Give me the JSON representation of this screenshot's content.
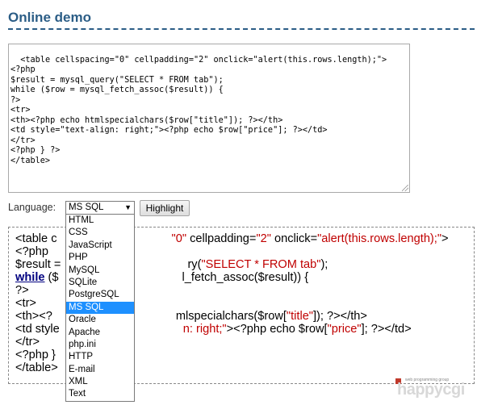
{
  "header": {
    "title": "Online demo"
  },
  "editor": {
    "code": "<table cellspacing=\"0\" cellpadding=\"2\" onclick=\"alert(this.rows.length);\">\n<?php\n$result = mysql_query(\"SELECT * FROM tab\");\nwhile ($row = mysql_fetch_assoc($result)) {\n?>\n<tr>\n<th><?php echo htmlspecialchars($row[\"title\"]); ?></th>\n<td style=\"text-align: right;\"><?php echo $row[\"price\"]; ?></td>\n</tr>\n<?php } ?>\n</table>"
  },
  "controls": {
    "language_label": "Language:",
    "selected_language": "MS SQL",
    "highlight_button": "Highlight"
  },
  "dropdown": {
    "options": [
      "HTML",
      "CSS",
      "JavaScript",
      "PHP",
      "MySQL",
      "SQLite",
      "PostgreSQL",
      "MS SQL",
      "Oracle",
      "Apache",
      "php.ini",
      "HTTP",
      "E-mail",
      "XML",
      "Text"
    ],
    "selected_index": 7
  },
  "output": {
    "lines": [
      [
        {
          "t": "<table c"
        },
        {
          "t": "\"0\"",
          "c": "str",
          "gap": 142
        },
        {
          "t": " cellpadding="
        },
        {
          "t": "\"2\"",
          "c": "str"
        },
        {
          "t": " onclick="
        },
        {
          "t": "\"alert(this.rows.length);\"",
          "c": "str"
        },
        {
          "t": ">"
        }
      ],
      [
        {
          "t": "<?php"
        }
      ],
      [
        {
          "t": "$result = "
        },
        {
          "t": "ry(",
          "gap": 153
        },
        {
          "t": "\"SELECT * FROM tab\"",
          "c": "str"
        },
        {
          "t": ");"
        }
      ],
      [
        {
          "t": "while",
          "c": "kw"
        },
        {
          "t": " ($"
        },
        {
          "t": "l_fetch_assoc($result)) {",
          "gap": 153
        }
      ],
      [
        {
          "t": "?>"
        }
      ],
      [
        {
          "t": "<tr>"
        }
      ],
      [
        {
          "t": "<th><?"
        },
        {
          "t": "mlspecialchars($row[",
          "gap": 153
        },
        {
          "t": "\"title\"",
          "c": "str"
        },
        {
          "t": "]); ?></th>"
        }
      ],
      [
        {
          "t": "<td style"
        },
        {
          "t": "n: right;\"",
          "c": "str",
          "gap": 153
        },
        {
          "t": "><?php echo $row["
        },
        {
          "t": "\"price\"",
          "c": "str"
        },
        {
          "t": "]; ?></td>"
        }
      ],
      [
        {
          "t": "</tr>"
        }
      ],
      [
        {
          "t": "<?php }"
        }
      ],
      [
        {
          "t": "</table>"
        }
      ]
    ]
  },
  "logo": {
    "small_text": "web programming group",
    "brand": "happycgi",
    "accent": "#c0392b"
  }
}
